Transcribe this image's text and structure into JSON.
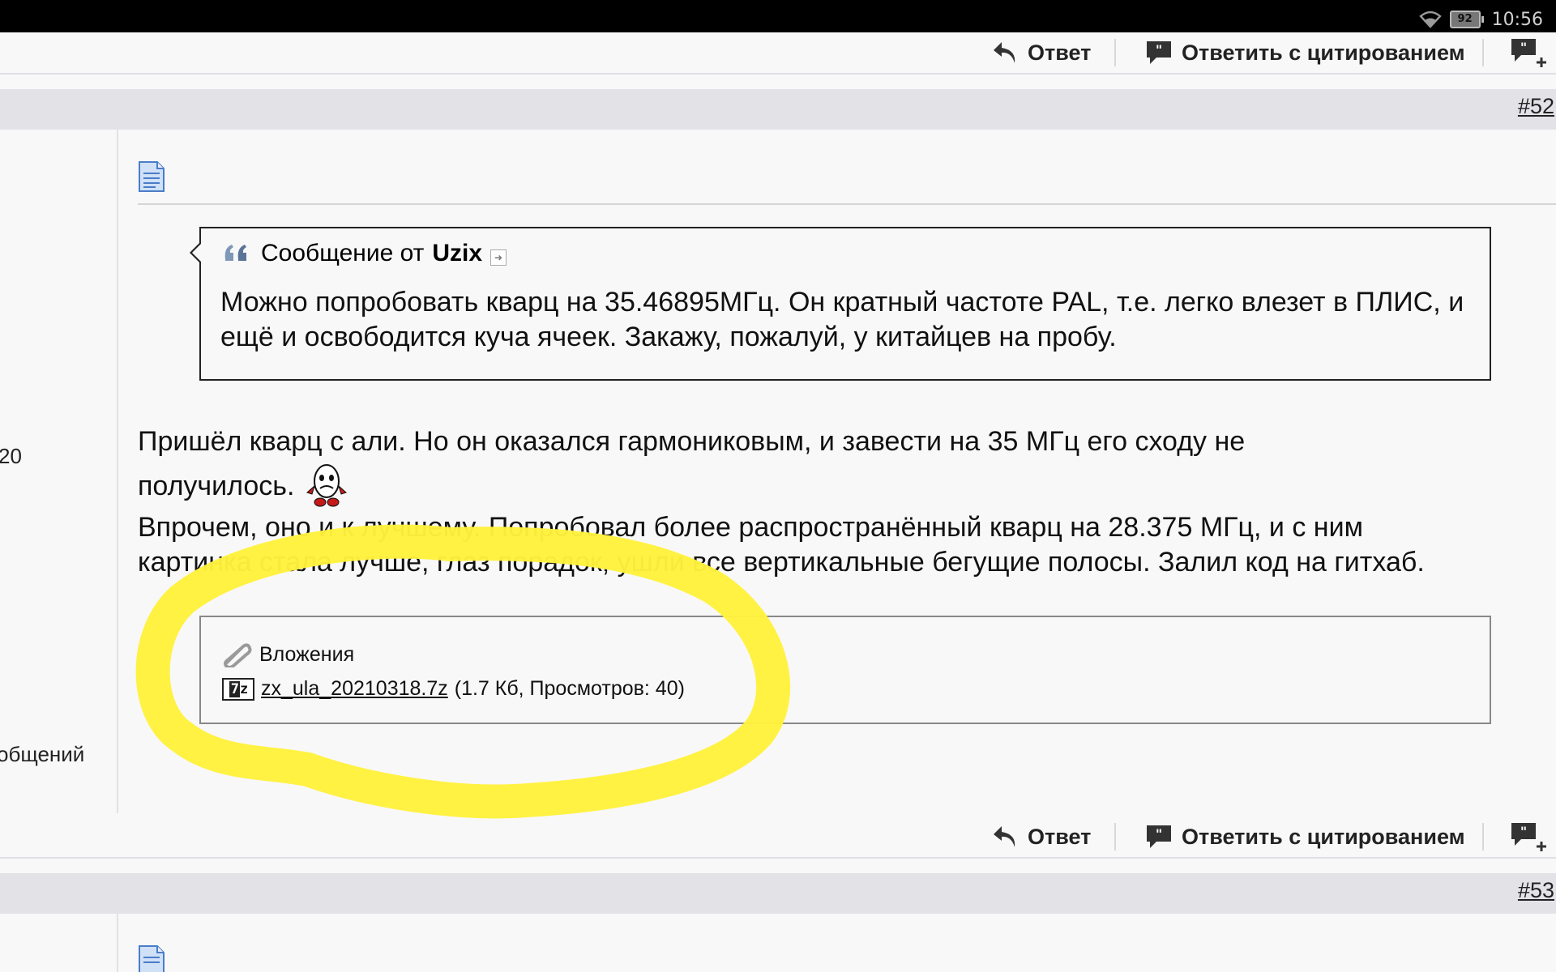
{
  "status_bar": {
    "battery": "92",
    "time": "10:56"
  },
  "actions": {
    "reply": "Ответ",
    "quote_reply": "Ответить с цитированием"
  },
  "post_52": {
    "number": "#52",
    "user_fragments": [
      "20",
      "общений"
    ],
    "quote": {
      "prefix": "Сообщение от",
      "author": "Uzix",
      "text": "Можно попробовать кварц на 35.46895МГц. Он кратный частоте PAL, т.е. легко влезет в ПЛИС, и ещё и освободится куча ячеек. Закажу, пожалуй, у китайцев на пробу."
    },
    "message": {
      "line1": "Пришёл кварц с али. Но он оказался гармониковым, и завести на 35 МГц его сходу не",
      "line2": "получилось.",
      "line3": "Впрочем, оно и к лучшему. Попробовал более распространённый кварц на 28.375 МГц, и с ним",
      "line4": "картинка стала лучше, глаз порадок, ушли все вертикальные бегущие полосы. Залил код на гитхаб."
    },
    "attachments": {
      "title": "Вложения",
      "files": [
        {
          "name": "zx_ula_20210318.7z",
          "meta": "(1.7 Кб, Просмотров: 40)",
          "icon": "7z"
        }
      ]
    }
  },
  "post_53": {
    "number": "#53"
  },
  "colors": {
    "highlight": "#fff23d",
    "header_bar": "#e3e3e7",
    "background": "#f8f8f8"
  }
}
